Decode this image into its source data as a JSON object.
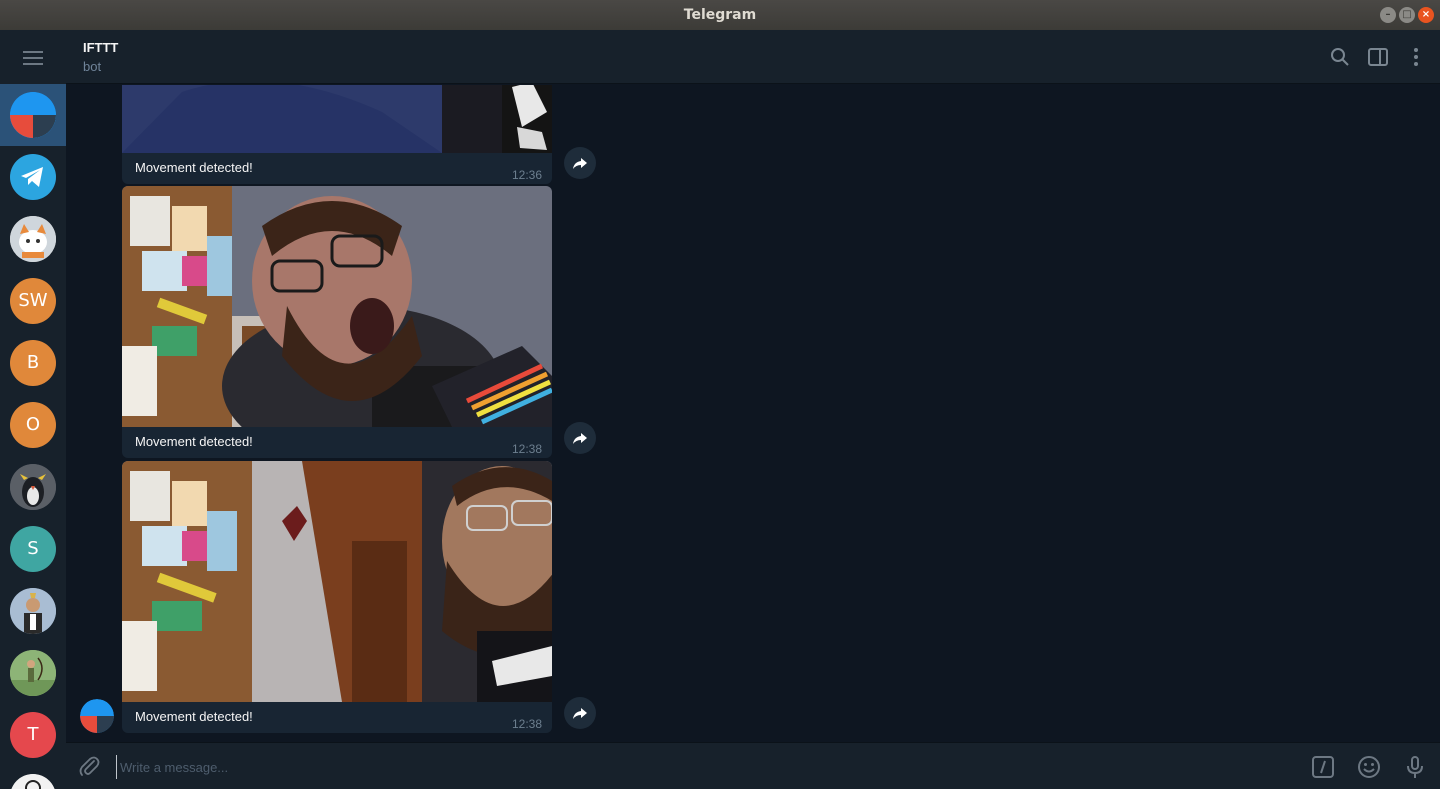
{
  "window": {
    "title": "Telegram"
  },
  "sidebar": {
    "menu_icon": "hamburger-icon",
    "chats": [
      {
        "initials": "",
        "kind": "ifttt-logo",
        "color": "#1e96f0",
        "active": true
      },
      {
        "initials": "",
        "kind": "telegram-logo",
        "color": "#2ca5e0"
      },
      {
        "initials": "",
        "kind": "photo",
        "color": "#d8d2c8"
      },
      {
        "initials": "SW",
        "kind": "initials",
        "color": "#e0883a"
      },
      {
        "initials": "B",
        "kind": "initials",
        "color": "#e0883a"
      },
      {
        "initials": "O",
        "kind": "initials",
        "color": "#e0883a"
      },
      {
        "initials": "",
        "kind": "photo",
        "color": "#4a4f58"
      },
      {
        "initials": "S",
        "kind": "initials",
        "color": "#3fa6a2"
      },
      {
        "initials": "",
        "kind": "photo",
        "color": "#7895b4"
      },
      {
        "initials": "",
        "kind": "photo",
        "color": "#7fa06a"
      },
      {
        "initials": "T",
        "kind": "initials",
        "color": "#e5484d"
      },
      {
        "initials": "",
        "kind": "photo",
        "color": "#e8e8e8"
      }
    ]
  },
  "header": {
    "chat_name": "IFTTT",
    "chat_status": "bot",
    "icons": [
      "search-icon",
      "sidebar-toggle-icon",
      "more-vertical-icon"
    ]
  },
  "messages": [
    {
      "caption": "Movement detected!",
      "time": "12:36"
    },
    {
      "caption": "Movement detected!",
      "time": "12:38"
    },
    {
      "caption": "Movement detected!",
      "time": "12:38"
    }
  ],
  "composer": {
    "placeholder": "Write a message...",
    "icons": [
      "attach-icon",
      "bot-command-icon",
      "emoji-icon",
      "microphone-icon"
    ]
  },
  "colors": {
    "background": "#0e1621",
    "panel": "#17212b",
    "bubble": "#182533",
    "active": "#2b5278",
    "accent": "#1e96f0"
  }
}
